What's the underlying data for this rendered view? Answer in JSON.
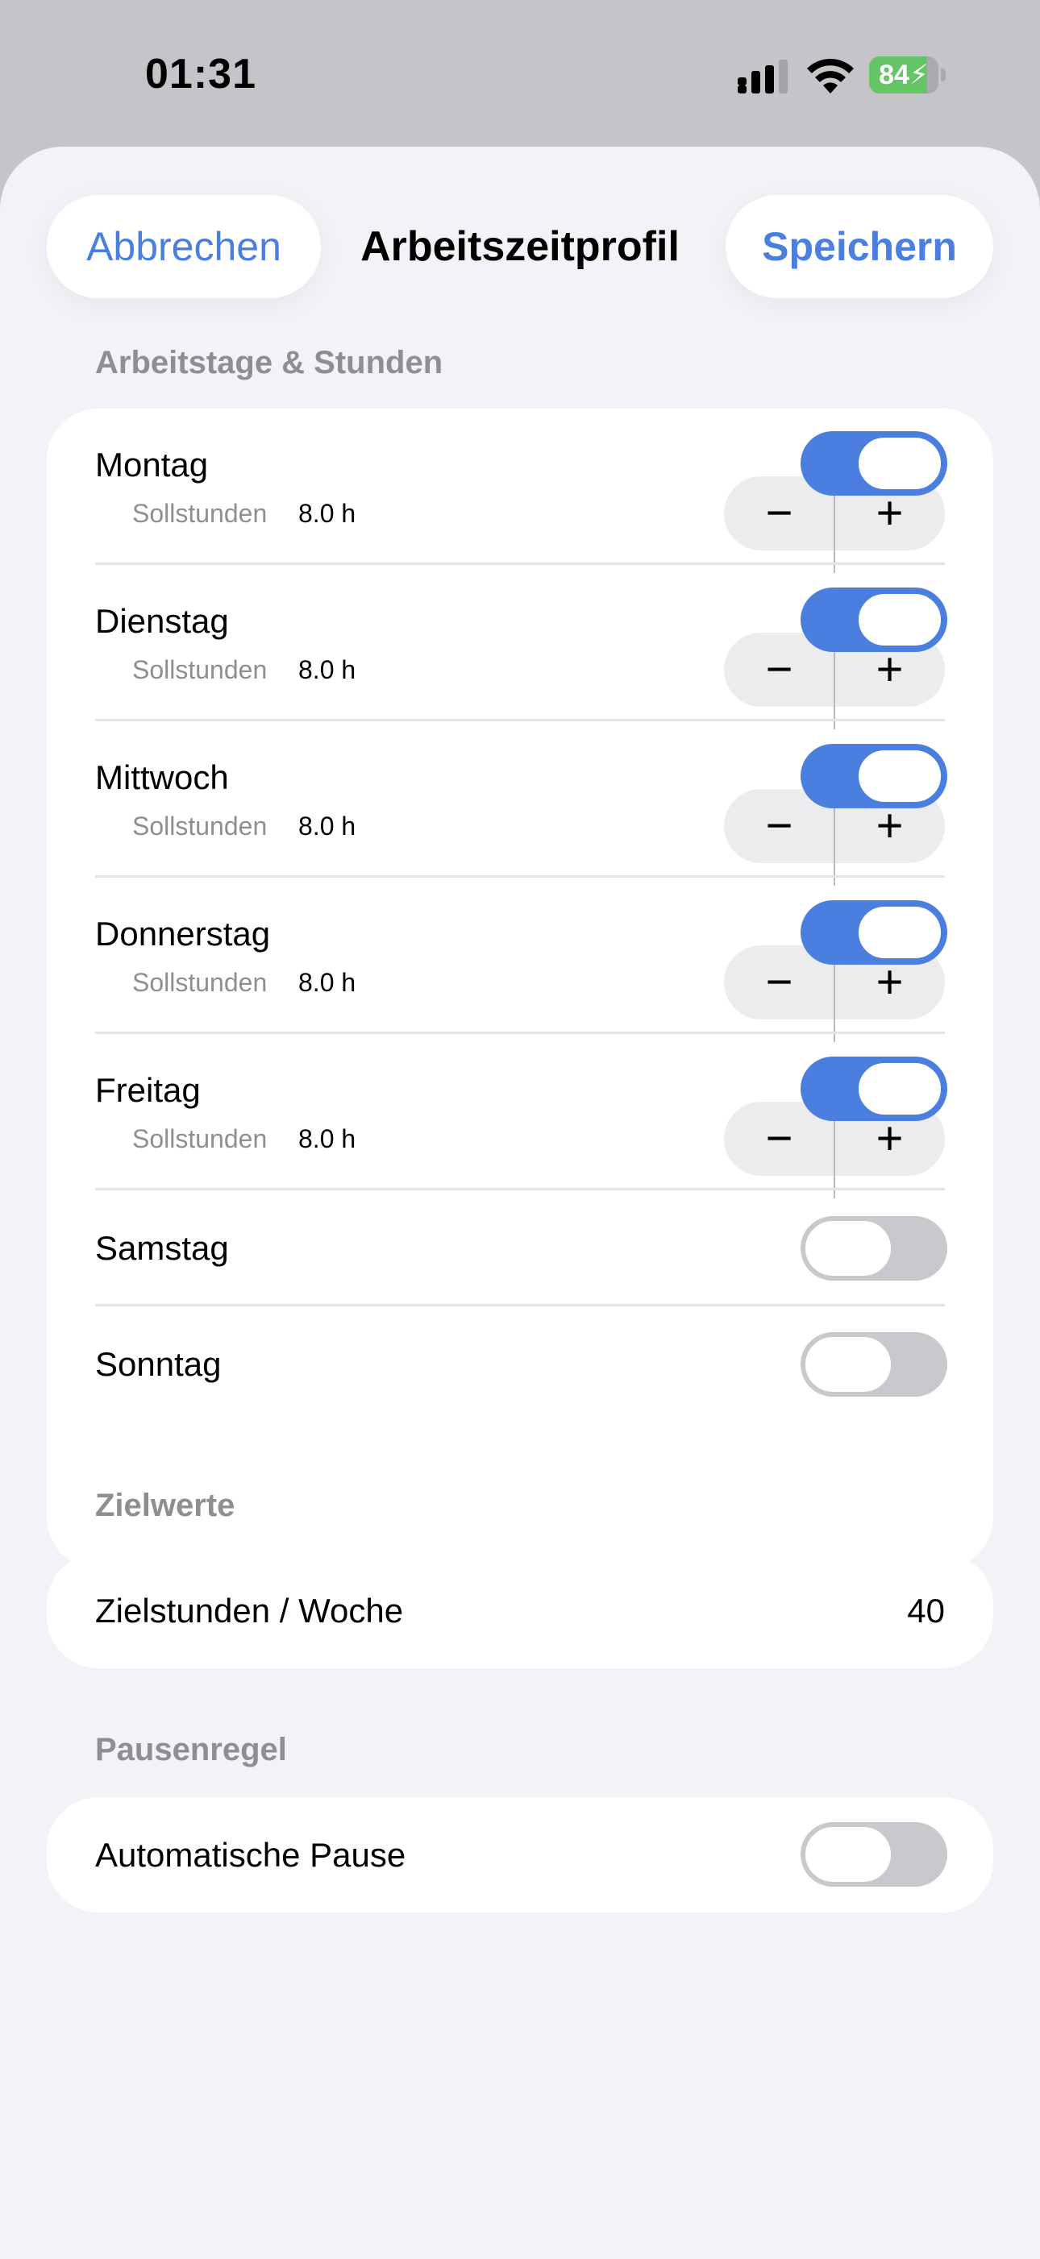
{
  "status_bar": {
    "time": "01:31",
    "battery_level": "84",
    "battery_fraction": 0.84,
    "signal_icon": "cellular-signal-icon",
    "wifi_icon": "wifi-icon",
    "battery_icon": "battery-charging-icon",
    "battery_fill_color": "#65c466"
  },
  "header": {
    "cancel_label": "Abbrechen",
    "title": "Arbeitszeitprofil",
    "save_label": "Speichern"
  },
  "colors": {
    "accent": "#4a7fe0",
    "background": "#f2f2f7",
    "secondary_text": "#8e8e93"
  },
  "workdays": {
    "section_title": "Arbeitstage & Stunden",
    "hours_label": "Sollstunden",
    "days": [
      {
        "name": "Montag",
        "enabled": true,
        "hours": "8.0 h"
      },
      {
        "name": "Dienstag",
        "enabled": true,
        "hours": "8.0 h"
      },
      {
        "name": "Mittwoch",
        "enabled": true,
        "hours": "8.0 h"
      },
      {
        "name": "Donnerstag",
        "enabled": true,
        "hours": "8.0 h"
      },
      {
        "name": "Freitag",
        "enabled": true,
        "hours": "8.0 h"
      },
      {
        "name": "Samstag",
        "enabled": false
      },
      {
        "name": "Sonntag",
        "enabled": false
      }
    ],
    "minus_symbol": "−",
    "plus_symbol": "+"
  },
  "targets": {
    "section_title": "Zielwerte",
    "weekly_hours_label": "Zielstunden / Woche",
    "weekly_hours_value": "40"
  },
  "breaks": {
    "section_title": "Pausenregel",
    "auto_break_label": "Automatische Pause",
    "auto_break_enabled": false
  }
}
